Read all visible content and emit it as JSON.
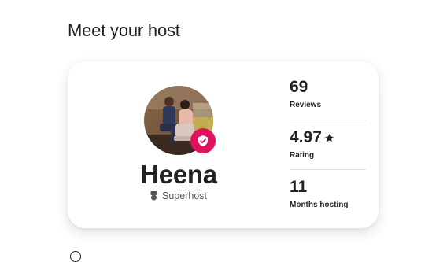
{
  "section": {
    "title": "Meet your host"
  },
  "host": {
    "name": "Heena",
    "badge_label": "Superhost",
    "verified_color": "#e0115f",
    "avatar_icon": "host-photo",
    "verified_icon": "shield-check-icon",
    "superhost_icon": "superhost-medal-icon"
  },
  "stats": [
    {
      "value": "69",
      "label": "Reviews",
      "icon": ""
    },
    {
      "value": "4.97",
      "label": "Rating",
      "icon": "star-icon"
    },
    {
      "value": "11",
      "label": "Months hosting",
      "icon": ""
    }
  ]
}
